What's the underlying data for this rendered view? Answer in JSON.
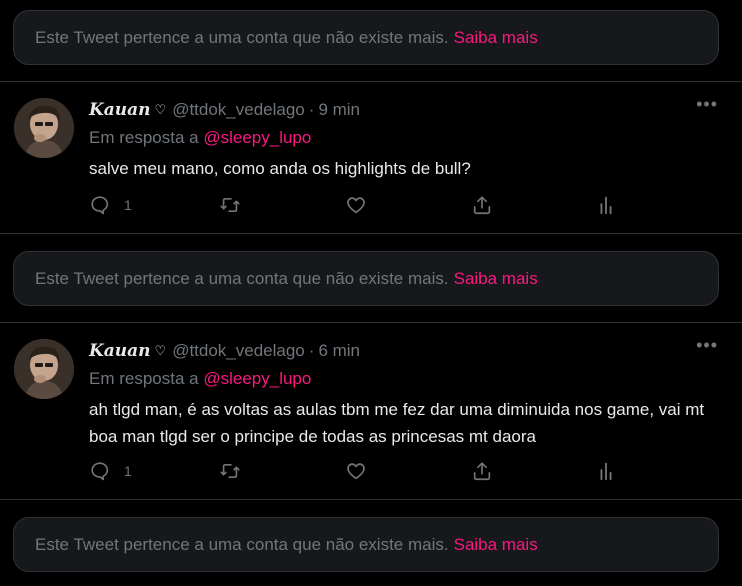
{
  "notice": {
    "text": "Este Tweet pertence a uma conta que não existe mais.",
    "link": "Saiba mais"
  },
  "tweets": [
    {
      "name": "Kauan",
      "name_symbol": "♡",
      "handle": "@ttdok_vedelago",
      "dot": "·",
      "time": "9 min",
      "reply_prefix": "Em resposta a",
      "reply_to": "@sleepy_lupo",
      "text": "salve meu mano, como anda os highlights de bull?",
      "reply_count": "1"
    },
    {
      "name": "Kauan",
      "name_symbol": "♡",
      "handle": "@ttdok_vedelago",
      "dot": "·",
      "time": "6 min",
      "reply_prefix": "Em resposta a",
      "reply_to": "@sleepy_lupo",
      "text": "ah tlgd man, é as voltas as aulas tbm me fez dar uma diminuida nos game, vai mt boa man tlgd ser o principe de todas as princesas mt daora",
      "reply_count": "1"
    }
  ],
  "icons": {
    "more": "more-horizontal-icon",
    "reply": "reply-icon",
    "retweet": "retweet-icon",
    "like": "like-icon",
    "share": "share-icon",
    "analytics": "analytics-icon"
  },
  "colors": {
    "background": "#000000",
    "card": "#16181c",
    "border": "#2f3336",
    "text": "#e7e9ea",
    "muted": "#71767b",
    "accent": "#f91880"
  },
  "more_label": "•••"
}
